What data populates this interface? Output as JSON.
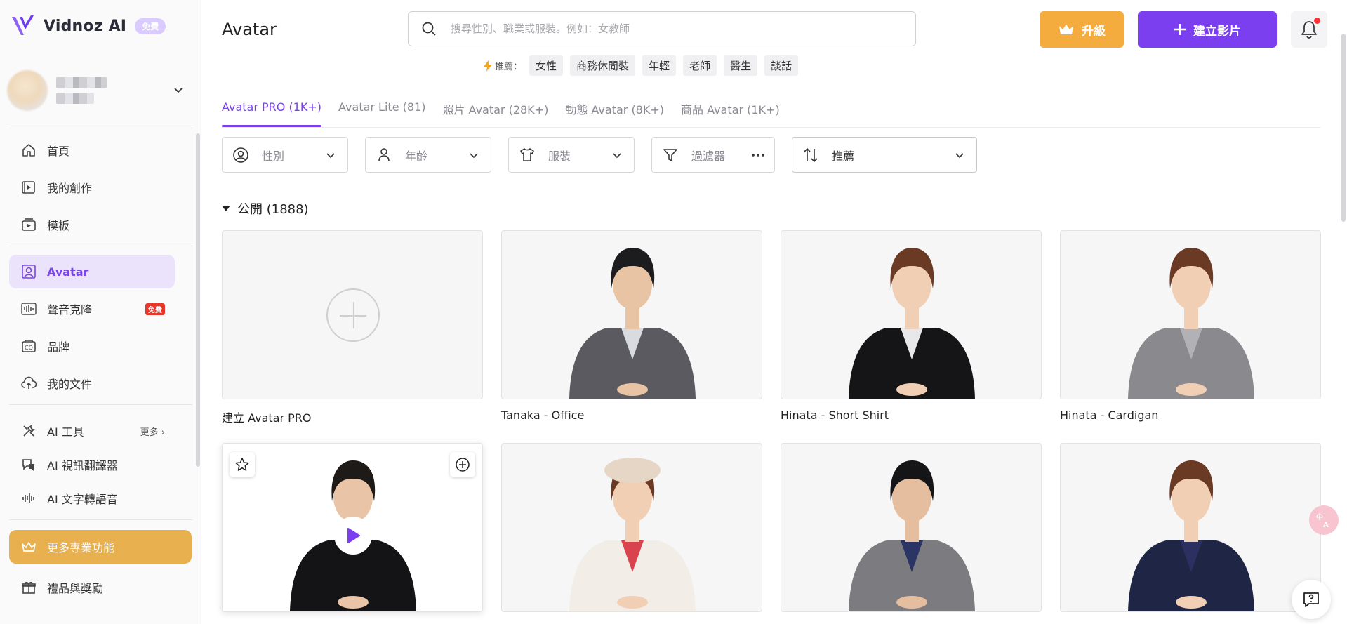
{
  "brand": {
    "name": "Vidnoz AI",
    "plan_badge": "免費"
  },
  "sidebar": {
    "items": [
      {
        "label": "首頁",
        "icon": "home-icon"
      },
      {
        "label": "我的創作",
        "icon": "video-play-icon"
      },
      {
        "label": "模板",
        "icon": "template-icon"
      },
      {
        "label": "Avatar",
        "icon": "avatar-icon",
        "active": true
      },
      {
        "label": "聲音克隆",
        "icon": "waveform-icon",
        "badge": "免費"
      },
      {
        "label": "品牌",
        "icon": "brand-icon"
      },
      {
        "label": "我的文件",
        "icon": "upload-cloud-icon"
      },
      {
        "label": "AI 工具",
        "icon": "tools-icon",
        "more": "更多"
      },
      {
        "label": "AI 視訊翻譯器",
        "icon": "translate-icon"
      },
      {
        "label": "AI 文字轉語音",
        "icon": "tts-icon"
      }
    ],
    "pro_button": "更多專業功能",
    "gift_item": "禮品與獎勵"
  },
  "header": {
    "title": "Avatar",
    "search_placeholder": "搜尋性別、職業或服裝。例如：女教師",
    "recommend_label": "推薦：",
    "recommend_chips": [
      "女性",
      "商務休閒裝",
      "年輕",
      "老師",
      "醫生",
      "談話"
    ],
    "upgrade_label": "升級",
    "create_label": "建立影片"
  },
  "tabs": [
    {
      "label": "Avatar PRO (1K+)",
      "active": true
    },
    {
      "label": "Avatar Lite (81)"
    },
    {
      "label": "照片 Avatar (28K+)"
    },
    {
      "label": "動態 Avatar (8K+)"
    },
    {
      "label": "商品 Avatar (1K+)"
    }
  ],
  "filters": {
    "gender": "性別",
    "age": "年齡",
    "outfit": "服裝",
    "filter": "過濾器",
    "sort": "推薦"
  },
  "section": {
    "title": "公開 (1888)"
  },
  "cards": [
    {
      "label": "建立 Avatar PRO",
      "type": "create"
    },
    {
      "label": "Tanaka - Office",
      "type": "avatar",
      "skin": "#e8c3a4",
      "hair": "#1c1c1e",
      "outfit": "#5a5a60",
      "accent": "#d8dbe0"
    },
    {
      "label": "Hinata - Short Shirt",
      "type": "avatar",
      "skin": "#f1cfb4",
      "hair": "#6b3a24",
      "outfit": "#151517",
      "accent": "#e8e8ea"
    },
    {
      "label": "Hinata - Cardigan",
      "type": "avatar",
      "skin": "#f1cfb4",
      "hair": "#6b3a24",
      "outfit": "#8a8a8e",
      "accent": "#b2b2b6"
    },
    {
      "label": "",
      "type": "avatar-play",
      "skin": "#e9c4a6",
      "hair": "#1e1a18",
      "outfit": "#141416",
      "accent": "#141416"
    },
    {
      "label": "",
      "type": "avatar",
      "skin": "#f1cfb4",
      "hair": "#6b3a24",
      "outfit": "#f2ede6",
      "accent": "#d9434d",
      "hat": "#e6d6c6"
    },
    {
      "label": "",
      "type": "avatar",
      "skin": "#e5bea0",
      "hair": "#151517",
      "outfit": "#7b7b80",
      "accent": "#2a3566"
    },
    {
      "label": "",
      "type": "avatar",
      "skin": "#f1cfb4",
      "hair": "#6b3a24",
      "outfit": "#1f2545",
      "accent": "#2b3060"
    }
  ],
  "colors": {
    "accent": "#7b3ff0",
    "upgrade": "#f5ac3f",
    "pro_button": "#e8b04f"
  }
}
